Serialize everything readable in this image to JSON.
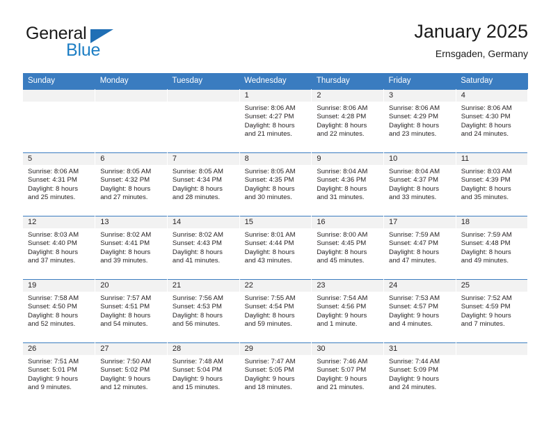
{
  "brand": {
    "name_top": "General",
    "name_bottom": "Blue",
    "color_dark": "#1a1a1a",
    "color_blue": "#1d7ec4"
  },
  "header": {
    "title": "January 2025",
    "subtitle": "Ernsgaden, Germany"
  },
  "theme": {
    "header_row_bg": "#3a7cc0",
    "header_row_text": "#ffffff",
    "daynum_band_bg": "#f2f2f2",
    "row_divider": "#3a7cc0",
    "body_text": "#231f20"
  },
  "weekdays": [
    "Sunday",
    "Monday",
    "Tuesday",
    "Wednesday",
    "Thursday",
    "Friday",
    "Saturday"
  ],
  "weeks": [
    [
      {
        "day": "",
        "lines": []
      },
      {
        "day": "",
        "lines": []
      },
      {
        "day": "",
        "lines": []
      },
      {
        "day": "1",
        "lines": [
          "Sunrise: 8:06 AM",
          "Sunset: 4:27 PM",
          "Daylight: 8 hours",
          "and 21 minutes."
        ]
      },
      {
        "day": "2",
        "lines": [
          "Sunrise: 8:06 AM",
          "Sunset: 4:28 PM",
          "Daylight: 8 hours",
          "and 22 minutes."
        ]
      },
      {
        "day": "3",
        "lines": [
          "Sunrise: 8:06 AM",
          "Sunset: 4:29 PM",
          "Daylight: 8 hours",
          "and 23 minutes."
        ]
      },
      {
        "day": "4",
        "lines": [
          "Sunrise: 8:06 AM",
          "Sunset: 4:30 PM",
          "Daylight: 8 hours",
          "and 24 minutes."
        ]
      }
    ],
    [
      {
        "day": "5",
        "lines": [
          "Sunrise: 8:06 AM",
          "Sunset: 4:31 PM",
          "Daylight: 8 hours",
          "and 25 minutes."
        ]
      },
      {
        "day": "6",
        "lines": [
          "Sunrise: 8:05 AM",
          "Sunset: 4:32 PM",
          "Daylight: 8 hours",
          "and 27 minutes."
        ]
      },
      {
        "day": "7",
        "lines": [
          "Sunrise: 8:05 AM",
          "Sunset: 4:34 PM",
          "Daylight: 8 hours",
          "and 28 minutes."
        ]
      },
      {
        "day": "8",
        "lines": [
          "Sunrise: 8:05 AM",
          "Sunset: 4:35 PM",
          "Daylight: 8 hours",
          "and 30 minutes."
        ]
      },
      {
        "day": "9",
        "lines": [
          "Sunrise: 8:04 AM",
          "Sunset: 4:36 PM",
          "Daylight: 8 hours",
          "and 31 minutes."
        ]
      },
      {
        "day": "10",
        "lines": [
          "Sunrise: 8:04 AM",
          "Sunset: 4:37 PM",
          "Daylight: 8 hours",
          "and 33 minutes."
        ]
      },
      {
        "day": "11",
        "lines": [
          "Sunrise: 8:03 AM",
          "Sunset: 4:39 PM",
          "Daylight: 8 hours",
          "and 35 minutes."
        ]
      }
    ],
    [
      {
        "day": "12",
        "lines": [
          "Sunrise: 8:03 AM",
          "Sunset: 4:40 PM",
          "Daylight: 8 hours",
          "and 37 minutes."
        ]
      },
      {
        "day": "13",
        "lines": [
          "Sunrise: 8:02 AM",
          "Sunset: 4:41 PM",
          "Daylight: 8 hours",
          "and 39 minutes."
        ]
      },
      {
        "day": "14",
        "lines": [
          "Sunrise: 8:02 AM",
          "Sunset: 4:43 PM",
          "Daylight: 8 hours",
          "and 41 minutes."
        ]
      },
      {
        "day": "15",
        "lines": [
          "Sunrise: 8:01 AM",
          "Sunset: 4:44 PM",
          "Daylight: 8 hours",
          "and 43 minutes."
        ]
      },
      {
        "day": "16",
        "lines": [
          "Sunrise: 8:00 AM",
          "Sunset: 4:45 PM",
          "Daylight: 8 hours",
          "and 45 minutes."
        ]
      },
      {
        "day": "17",
        "lines": [
          "Sunrise: 7:59 AM",
          "Sunset: 4:47 PM",
          "Daylight: 8 hours",
          "and 47 minutes."
        ]
      },
      {
        "day": "18",
        "lines": [
          "Sunrise: 7:59 AM",
          "Sunset: 4:48 PM",
          "Daylight: 8 hours",
          "and 49 minutes."
        ]
      }
    ],
    [
      {
        "day": "19",
        "lines": [
          "Sunrise: 7:58 AM",
          "Sunset: 4:50 PM",
          "Daylight: 8 hours",
          "and 52 minutes."
        ]
      },
      {
        "day": "20",
        "lines": [
          "Sunrise: 7:57 AM",
          "Sunset: 4:51 PM",
          "Daylight: 8 hours",
          "and 54 minutes."
        ]
      },
      {
        "day": "21",
        "lines": [
          "Sunrise: 7:56 AM",
          "Sunset: 4:53 PM",
          "Daylight: 8 hours",
          "and 56 minutes."
        ]
      },
      {
        "day": "22",
        "lines": [
          "Sunrise: 7:55 AM",
          "Sunset: 4:54 PM",
          "Daylight: 8 hours",
          "and 59 minutes."
        ]
      },
      {
        "day": "23",
        "lines": [
          "Sunrise: 7:54 AM",
          "Sunset: 4:56 PM",
          "Daylight: 9 hours",
          "and 1 minute."
        ]
      },
      {
        "day": "24",
        "lines": [
          "Sunrise: 7:53 AM",
          "Sunset: 4:57 PM",
          "Daylight: 9 hours",
          "and 4 minutes."
        ]
      },
      {
        "day": "25",
        "lines": [
          "Sunrise: 7:52 AM",
          "Sunset: 4:59 PM",
          "Daylight: 9 hours",
          "and 7 minutes."
        ]
      }
    ],
    [
      {
        "day": "26",
        "lines": [
          "Sunrise: 7:51 AM",
          "Sunset: 5:01 PM",
          "Daylight: 9 hours",
          "and 9 minutes."
        ]
      },
      {
        "day": "27",
        "lines": [
          "Sunrise: 7:50 AM",
          "Sunset: 5:02 PM",
          "Daylight: 9 hours",
          "and 12 minutes."
        ]
      },
      {
        "day": "28",
        "lines": [
          "Sunrise: 7:48 AM",
          "Sunset: 5:04 PM",
          "Daylight: 9 hours",
          "and 15 minutes."
        ]
      },
      {
        "day": "29",
        "lines": [
          "Sunrise: 7:47 AM",
          "Sunset: 5:05 PM",
          "Daylight: 9 hours",
          "and 18 minutes."
        ]
      },
      {
        "day": "30",
        "lines": [
          "Sunrise: 7:46 AM",
          "Sunset: 5:07 PM",
          "Daylight: 9 hours",
          "and 21 minutes."
        ]
      },
      {
        "day": "31",
        "lines": [
          "Sunrise: 7:44 AM",
          "Sunset: 5:09 PM",
          "Daylight: 9 hours",
          "and 24 minutes."
        ]
      },
      {
        "day": "",
        "lines": []
      }
    ]
  ]
}
